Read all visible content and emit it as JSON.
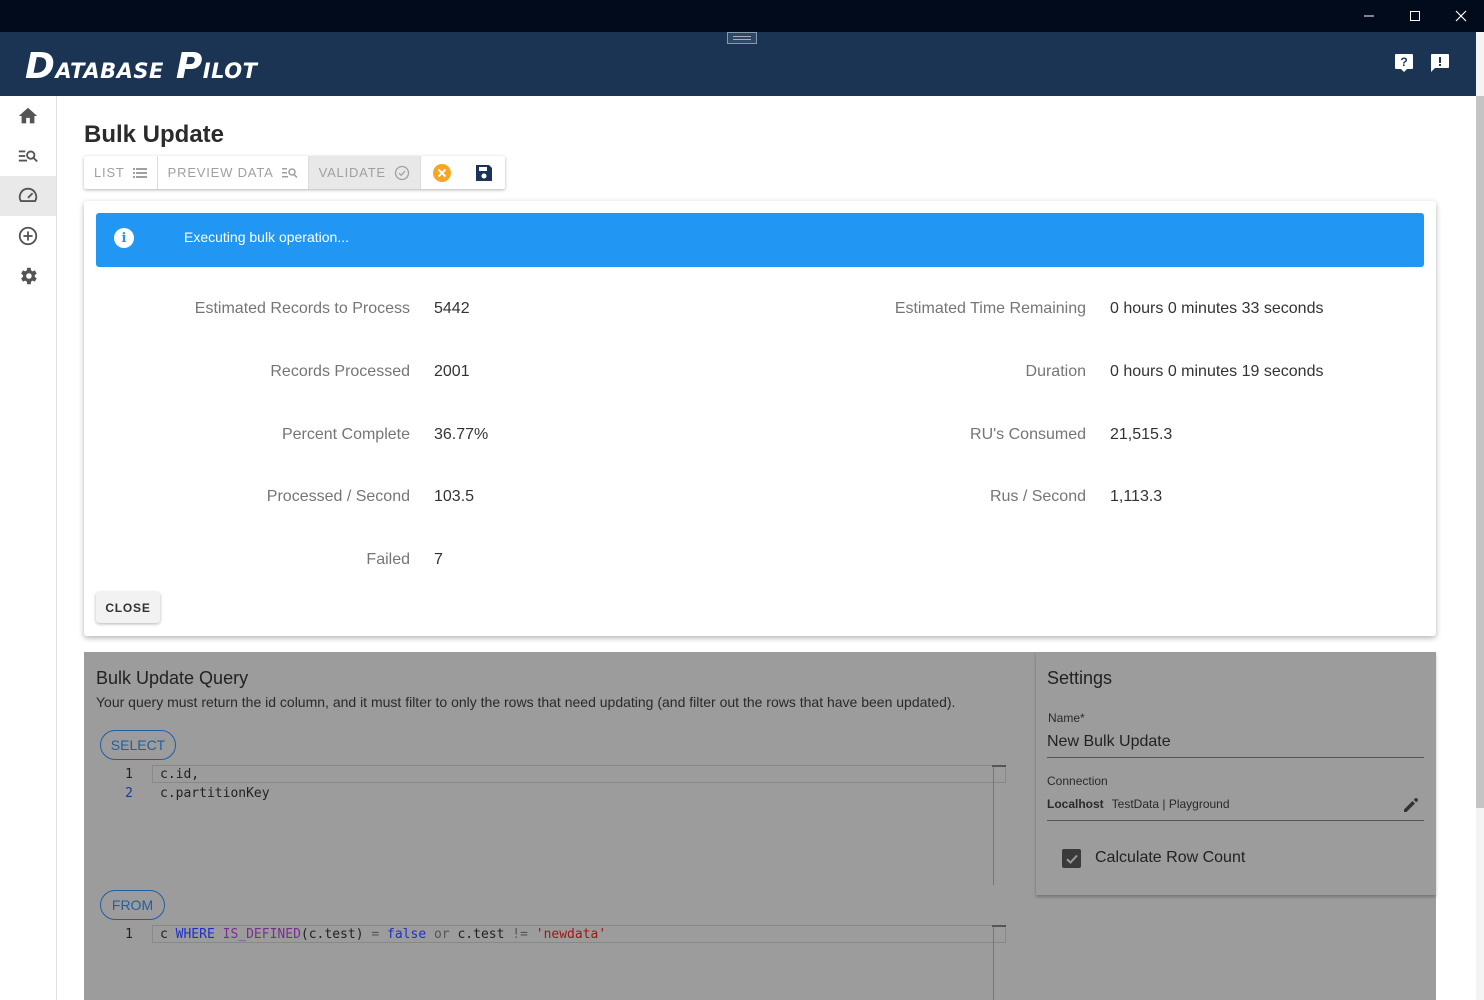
{
  "window": {
    "minimize_icon": "minimize-icon",
    "maximize_icon": "maximize-icon",
    "close_icon": "close-icon"
  },
  "app": {
    "logo_word1_initial": "D",
    "logo_word1_rest": "ATABASE",
    "logo_word2_initial": "P",
    "logo_word2_rest": "ILOT",
    "help_icon": "help-icon",
    "feedback_icon": "feedback-icon"
  },
  "sidebar": {
    "items": [
      {
        "icon": "home-icon"
      },
      {
        "icon": "search-list-icon"
      },
      {
        "icon": "speedometer-icon",
        "active": true
      },
      {
        "icon": "add-circle-icon"
      },
      {
        "icon": "gear-icon"
      }
    ]
  },
  "page": {
    "title": "Bulk Update"
  },
  "toolbar": {
    "list_label": "LIST",
    "preview_label": "PREVIEW DATA",
    "validate_label": "VALIDATE",
    "cancel_icon": "cancel-icon",
    "save_icon": "save-icon"
  },
  "dialog": {
    "alert_text": "Executing bulk operation...",
    "stats_left": [
      {
        "label": "Estimated Records to Process",
        "value": "5442"
      },
      {
        "label": "Records Processed",
        "value": "2001"
      },
      {
        "label": "Percent Complete",
        "value": "36.77%"
      },
      {
        "label": "Processed / Second",
        "value": "103.5"
      },
      {
        "label": "Failed",
        "value": "7"
      }
    ],
    "stats_right": [
      {
        "label": "Estimated Time Remaining",
        "value": "0 hours 0 minutes 33 seconds"
      },
      {
        "label": "Duration",
        "value": "0 hours 0 minutes 19 seconds"
      },
      {
        "label": "RU's Consumed",
        "value": "21,515.3"
      },
      {
        "label": "Rus / Second",
        "value": "1,113.3"
      }
    ],
    "close_label": "CLOSE"
  },
  "query": {
    "title": "Bulk Update Query",
    "description": "Your query must return the id column, and it must filter to only the rows that need updating (and filter out the rows that have been updated).",
    "select_chip": "SELECT",
    "select_lines": [
      {
        "no": "1",
        "text": "c.id,"
      },
      {
        "no": "2",
        "text": "c.partitionKey"
      }
    ],
    "from_chip": "FROM",
    "from_line_no": "1",
    "from_tokens": {
      "t1": "c ",
      "t2": "WHERE",
      "t3": " ",
      "t4": "IS_DEFINED",
      "t5": "(c.test) ",
      "t6": "=",
      "t7": " ",
      "t8": "false",
      "t9": " ",
      "t10": "or",
      "t11": " c.test ",
      "t12": "!=",
      "t13": " ",
      "t14": "'newdata'"
    }
  },
  "settings": {
    "title": "Settings",
    "name_label": "Name*",
    "name_value": "New Bulk Update",
    "connection_label": "Connection",
    "connection_host": "Localhost",
    "connection_path": "TestData | Playground",
    "edit_icon": "pencil-icon",
    "calc_row_count_label": "Calculate Row Count",
    "calc_row_count_checked": true
  }
}
